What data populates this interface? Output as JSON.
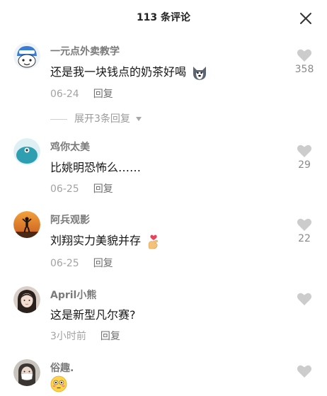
{
  "header": {
    "title": "113 条评论"
  },
  "comments": [
    {
      "username": "一元点外卖教学",
      "text": "还是我一块钱点的奶茶好喝",
      "date": "06-24",
      "reply": "回复",
      "likes": "358",
      "avatar": "helmet-cartoon-avatar",
      "emoji": "husky-dog-emoji"
    },
    {
      "username": "鸡你太美",
      "text": "比姚明恐怖么……",
      "date": "06-25",
      "reply": "回复",
      "likes": "29",
      "avatar": "teal-cartoon-avatar"
    },
    {
      "username": "阿兵观影",
      "text": "刘翔实力美貌并存",
      "date": "06-25",
      "reply": "回复",
      "likes": "22",
      "avatar": "sunset-silhouette-avatar",
      "emoji": "finger-heart-emoji"
    },
    {
      "username": "April小熊",
      "text": "这是新型凡尔赛?",
      "date": "3小时前",
      "reply": "回复",
      "likes": "",
      "avatar": "girl-photo-avatar"
    },
    {
      "username": "俗趣.",
      "text": "",
      "date": "",
      "reply": "",
      "likes": "",
      "avatar": "masked-person-avatar",
      "emoji": "flushed-face-emoji"
    }
  ],
  "expand_replies": {
    "label": "展开3条回复"
  },
  "colors": {
    "heart": "#cccccc",
    "name": "#7a7a7a",
    "meta": "#a3a3a3"
  }
}
